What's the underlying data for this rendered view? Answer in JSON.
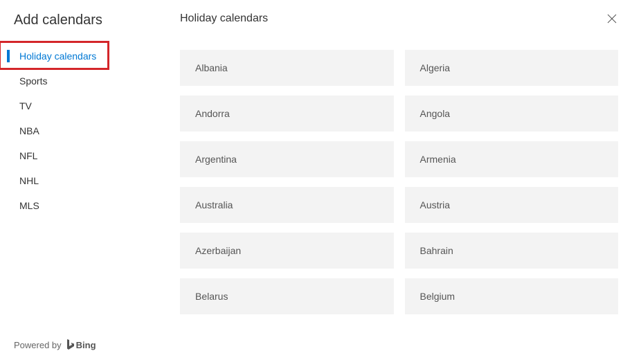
{
  "sidebar": {
    "title": "Add calendars",
    "items": [
      {
        "label": "Holiday calendars",
        "active": true
      },
      {
        "label": "Sports",
        "active": false
      },
      {
        "label": "TV",
        "active": false
      },
      {
        "label": "NBA",
        "active": false
      },
      {
        "label": "NFL",
        "active": false
      },
      {
        "label": "NHL",
        "active": false
      },
      {
        "label": "MLS",
        "active": false
      }
    ],
    "powered_by_label": "Powered by",
    "powered_by_brand": "Bing"
  },
  "main": {
    "title": "Holiday calendars",
    "countries": [
      "Albania",
      "Algeria",
      "Andorra",
      "Angola",
      "Argentina",
      "Armenia",
      "Australia",
      "Austria",
      "Azerbaijan",
      "Bahrain",
      "Belarus",
      "Belgium"
    ]
  },
  "annotation": {
    "highlight_target": "sidebar-item-holiday-calendars"
  }
}
